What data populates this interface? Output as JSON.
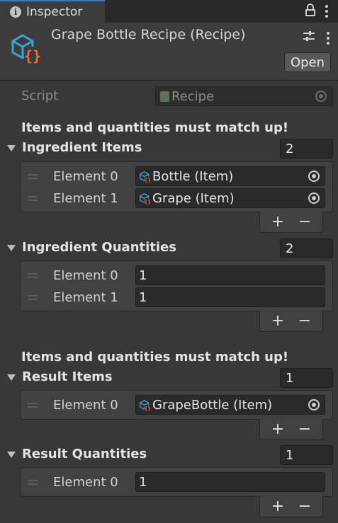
{
  "tab": {
    "title": "Inspector"
  },
  "header": {
    "title": "Grape Bottle Recipe (Recipe)",
    "open_label": "Open"
  },
  "script": {
    "label": "Script",
    "value": "Recipe"
  },
  "warnings": {
    "match_warning": "Items and quantities must match up!"
  },
  "lists": [
    {
      "title": "Ingredient Items",
      "size": "2",
      "elements": [
        {
          "label": "Element 0",
          "value": "Bottle (Item)",
          "is_object": true
        },
        {
          "label": "Element 1",
          "value": "Grape (Item)",
          "is_object": true
        }
      ]
    },
    {
      "title": "Ingredient Quantities",
      "size": "2",
      "elements": [
        {
          "label": "Element 0",
          "value": "1",
          "is_object": false
        },
        {
          "label": "Element 1",
          "value": "1",
          "is_object": false
        }
      ]
    },
    {
      "title": "Result Items",
      "size": "1",
      "elements": [
        {
          "label": "Element 0",
          "value": "GrapeBottle (Item)",
          "is_object": true
        }
      ]
    },
    {
      "title": "Result Quantities",
      "size": "1",
      "elements": [
        {
          "label": "Element 0",
          "value": "1",
          "is_object": false
        }
      ]
    }
  ],
  "footer": {
    "add_label": "+",
    "remove_label": "−"
  },
  "colors": {
    "background": "#383838",
    "tab_active_border": "#3a79bb",
    "icon_orange": "#e8703a",
    "icon_blue": "#3aa3d9"
  },
  "icons": {
    "tab": "info-icon",
    "asset": "scriptable-object-icon",
    "item": "scriptable-object-icon",
    "picker": "object-picker-icon"
  }
}
